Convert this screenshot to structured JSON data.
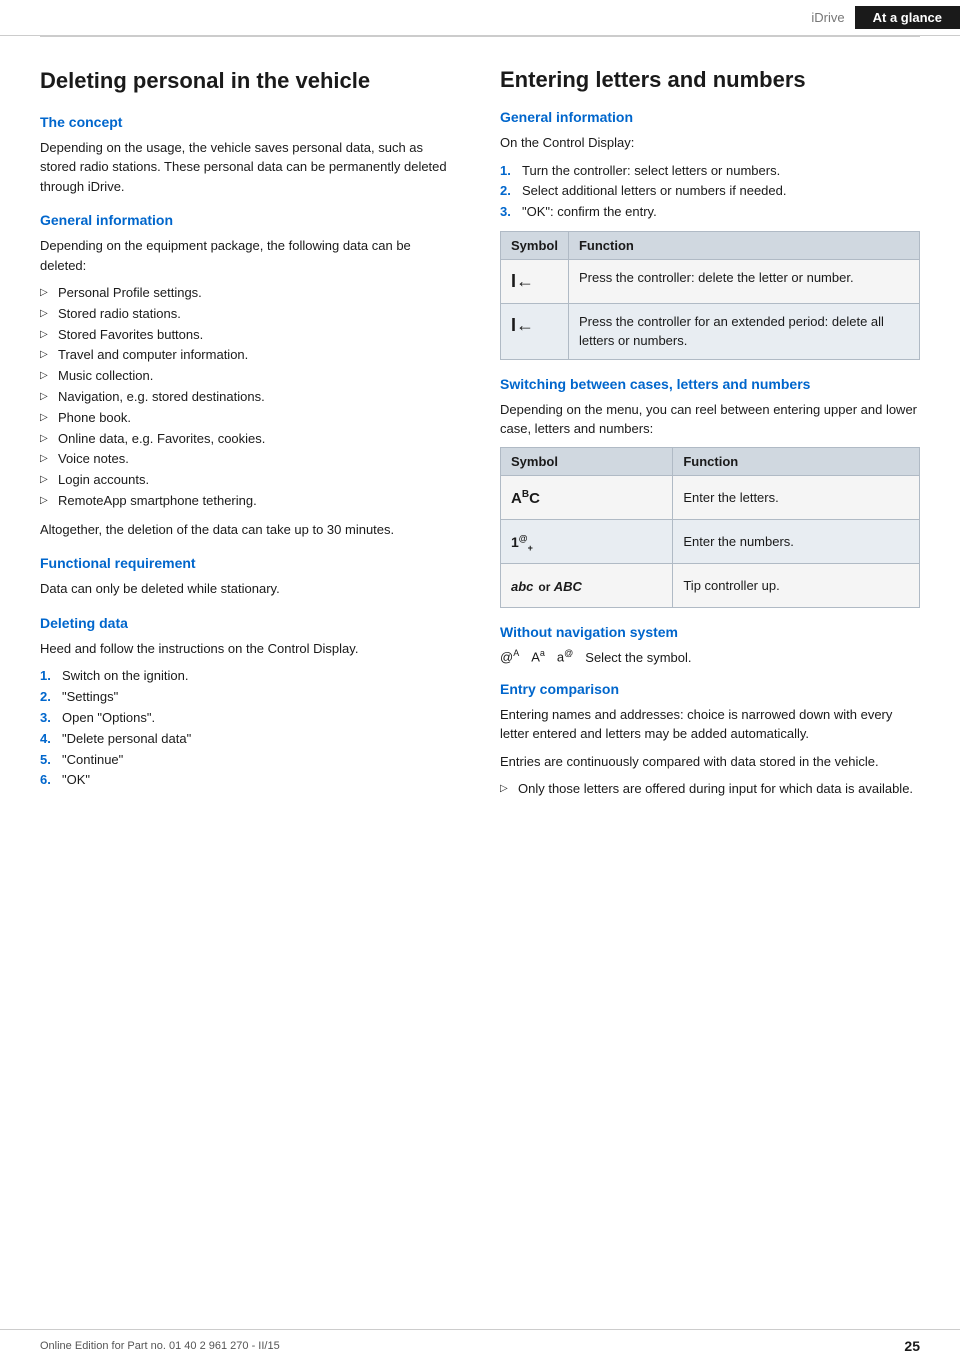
{
  "nav": {
    "brand": "iDrive",
    "active_tab": "At a glance"
  },
  "left_section": {
    "title": "Deleting personal in the vehicle",
    "concept": {
      "heading": "The concept",
      "body": "Depending on the usage, the vehicle saves personal data, such as stored radio stations. These personal data can be permanently deleted through iDrive."
    },
    "general_info": {
      "heading": "General information",
      "body": "Depending on the equipment package, the following data can be deleted:",
      "items": [
        "Personal Profile settings.",
        "Stored radio stations.",
        "Stored Favorites buttons.",
        "Travel and computer information.",
        "Music collection.",
        "Navigation, e.g. stored destinations.",
        "Phone book.",
        "Online data, e.g. Favorites, cookies.",
        "Voice notes.",
        "Login accounts.",
        "RemoteApp smartphone tethering."
      ],
      "footer": "Altogether, the deletion of the data can take up to 30 minutes."
    },
    "functional_req": {
      "heading": "Functional requirement",
      "body": "Data can only be deleted while stationary."
    },
    "deleting_data": {
      "heading": "Deleting data",
      "intro": "Heed and follow the instructions on the Control Display.",
      "steps": [
        "Switch on the ignition.",
        "\"Settings\"",
        "Open \"Options\".",
        "\"Delete personal data\"",
        "\"Continue\"",
        "\"OK\""
      ]
    }
  },
  "right_section": {
    "title": "Entering letters and numbers",
    "general_info": {
      "heading": "General information",
      "intro": "On the Control Display:",
      "steps": [
        "Turn the controller: select letters or numbers.",
        "Select additional letters or numbers if needed.",
        "\"OK\": confirm the entry."
      ]
    },
    "symbol_table": {
      "col1": "Symbol",
      "col2": "Function",
      "rows": [
        {
          "symbol": "I←",
          "function": "Press the controller: delete the letter or number."
        },
        {
          "symbol": "I←",
          "function": "Press the controller for an extended period: delete all letters or numbers."
        }
      ]
    },
    "switching": {
      "heading": "Switching between cases, letters and numbers",
      "body": "Depending on the menu, you can reel between entering upper and lower case, letters and numbers:",
      "col1": "Symbol",
      "col2": "Function",
      "rows": [
        {
          "symbol_type": "abc_super",
          "symbol_display": "AᴮC",
          "function": "Enter the letters."
        },
        {
          "symbol_type": "num",
          "symbol_display": "1®₊",
          "function": "Enter the numbers."
        },
        {
          "symbol_type": "abc_or_ABC",
          "symbol_display": "abc  or  ABC",
          "function": "Tip controller up."
        }
      ]
    },
    "without_nav": {
      "heading": "Without navigation system",
      "symbols": "@ᴮ  Aᵃ  a®",
      "text": "Select the symbol."
    },
    "entry_comparison": {
      "heading": "Entry comparison",
      "body1": "Entering names and addresses: choice is narrowed down with every letter entered and letters may be added automatically.",
      "body2": "Entries are continuously compared with data stored in the vehicle.",
      "item": "Only those letters are offered during input for which data is available."
    }
  },
  "footer": {
    "text": "Online Edition for Part no. 01 40 2 961 270 - II/15",
    "page_number": "25"
  }
}
